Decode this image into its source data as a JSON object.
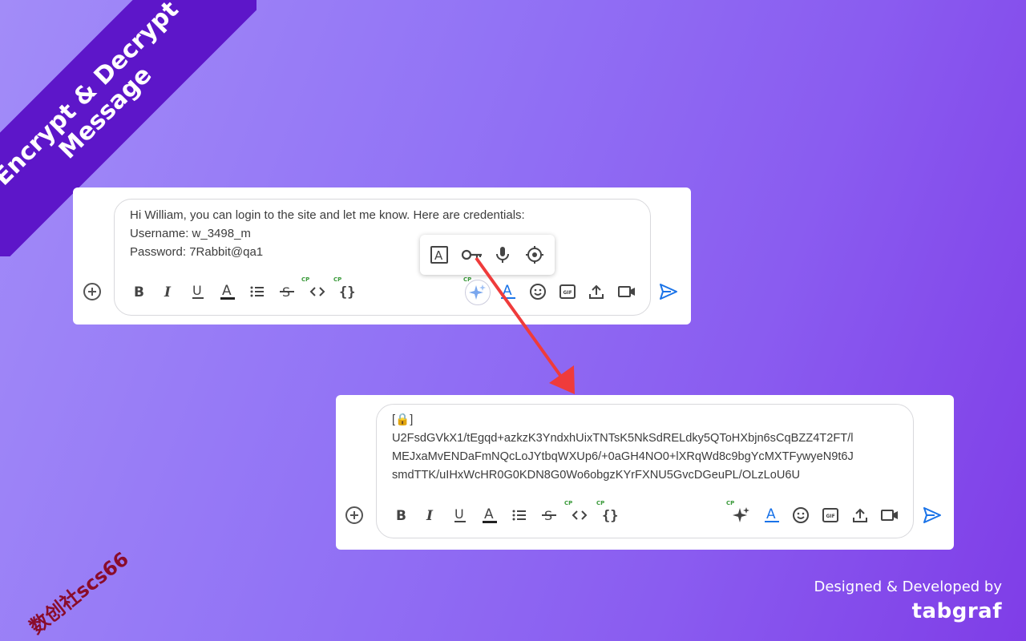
{
  "banner": {
    "line1": "Encrypt & Decrypt",
    "line2": "Message"
  },
  "top_composer": {
    "lines": [
      "Hi William, you can login to the site and let me know. Here are credentials:",
      "Username: w_3498_m",
      "Password: 7Rabbit@qa1"
    ],
    "popup_icons": [
      "text-format-icon",
      "key-icon",
      "microphone-icon",
      "target-icon"
    ]
  },
  "bottom_composer": {
    "lines": [
      "[🔒]",
      "U2FsdGVkX1/tEgqd+azkzK3YndxhUixTNTsK5NkSdRELdky5QToHXbjn6sCqBZZ4T2FT/l",
      "MEJxaMvENDaFmNQcLoJYtbqWXUp6/+0aGH4NO0+lXRqWd8c9bgYcMXTFywyeN9t6J",
      "smdTTK/uIHxWcHR0G0KDN8G0Wo6obgzKYrFXNU5GvcDGeuPL/OLzLoU6U"
    ]
  },
  "toolbar": {
    "badge": "CP",
    "icons": [
      "add-icon",
      "bold-icon",
      "italic-icon",
      "underline-icon",
      "text-color-icon",
      "bulleted-list-icon",
      "strikethrough-icon",
      "code-icon",
      "code-block-icon",
      "sparkle-icon",
      "font-color-icon",
      "emoji-icon",
      "gif-icon",
      "upload-icon",
      "video-icon",
      "send-icon"
    ]
  },
  "watermark": "数创社scs66",
  "signature": {
    "label": "Designed & Developed by",
    "brand": "tabgraf"
  },
  "colors": {
    "ribbon": "#5d16c9",
    "arrow": "#ef3b3b",
    "send": "#1a73e8"
  }
}
